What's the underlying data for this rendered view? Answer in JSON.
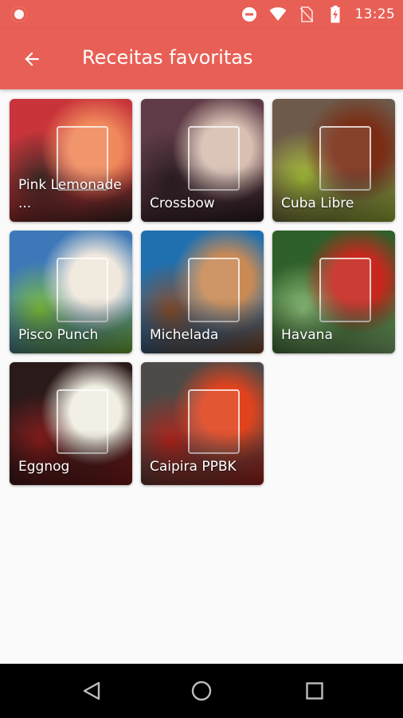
{
  "status_bar": {
    "time": "13:25",
    "icons": [
      "notification-dot-icon",
      "do-not-disturb-icon",
      "wifi-icon",
      "no-sim-icon",
      "battery-charging-icon"
    ]
  },
  "app_bar": {
    "title": "Receitas favoritas",
    "back_icon": "arrow-back-icon"
  },
  "recipes": [
    {
      "name": "Pink Lemonade ...",
      "colors": [
        "#c8343a",
        "#f08a5c",
        "#3d2a26"
      ]
    },
    {
      "name": "Crossbow",
      "colors": [
        "#5e3b46",
        "#d7bfb2",
        "#2e1f24"
      ]
    },
    {
      "name": "Cuba Libre",
      "colors": [
        "#6d5a4a",
        "#7a2d15",
        "#a8c23a"
      ]
    },
    {
      "name": "Pisco Punch",
      "colors": [
        "#3d79b8",
        "#f0e8dc",
        "#7fbf3a"
      ]
    },
    {
      "name": "Michelada",
      "colors": [
        "#1f70b0",
        "#c98a55",
        "#8a4d2a"
      ]
    },
    {
      "name": "Havana",
      "colors": [
        "#2f5f2a",
        "#c6281e",
        "#8fc17b"
      ]
    },
    {
      "name": "Eggnog",
      "colors": [
        "#2b1a1a",
        "#f1efe2",
        "#8b1d1d"
      ]
    },
    {
      "name": "Caipira PPBK",
      "colors": [
        "#4e4a47",
        "#e0431e",
        "#b3241c"
      ]
    }
  ],
  "nav_bar": {
    "icons": [
      "nav-back-icon",
      "nav-home-icon",
      "nav-recents-icon"
    ]
  },
  "theme": {
    "accent": "#e85f55"
  }
}
